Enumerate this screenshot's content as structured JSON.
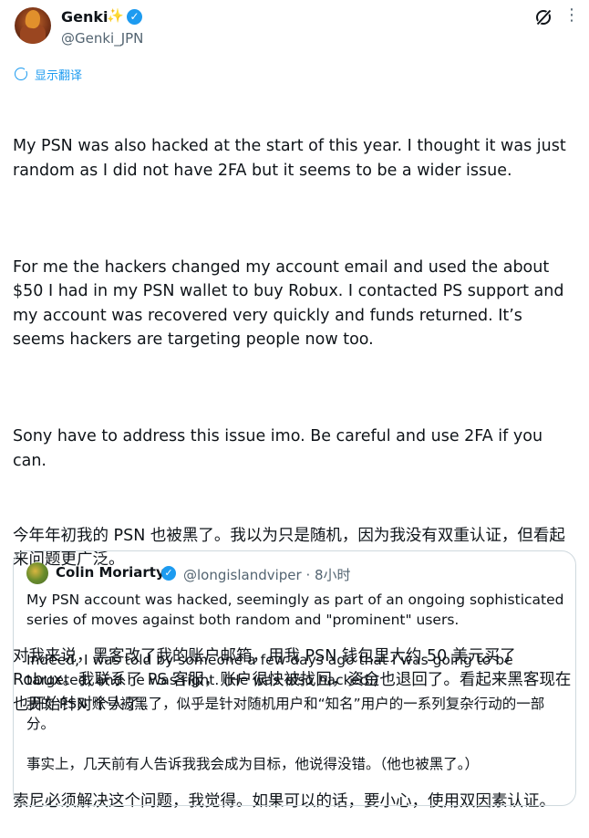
{
  "author": {
    "display_name": "Genki",
    "name_emoji": "✨",
    "handle": "@Genki_JPN"
  },
  "translate_label": "显示翻译",
  "tweet": {
    "en_p1": "My PSN was also hacked at the start of this year. I thought it was just random as I did not have 2FA but it seems to be a wider issue.",
    "en_p2": "For me the hackers changed my account email and used the about $50 I had in my PSN wallet to buy Robux. I contacted PS support and my account was recovered very quickly and funds returned. It’s seems hackers are targeting people now too.",
    "en_p3": "Sony have to address this issue imo. Be careful and use 2FA if you can.",
    "zh_p1": "今年年初我的 PSN 也被黑了。我以为只是随机，因为我没有双重认证，但看起来问题更广泛。",
    "zh_p2": "对我来说，黑客改了我的账户邮箱，用我 PSN 钱包里大约 50 美元买了Robux。我联系了 PS 客服，账户很快被找回，资金也退回了。看起来黑客现在也开始针对个人了。",
    "zh_p3": "索尼必须解决这个问题，我觉得。如果可以的话，要小心，使用双因素认证。"
  },
  "quote": {
    "display_name": "Colin Moriarty",
    "handle_time": "@longislandviper · 8小时",
    "en_p1": "My PSN account was hacked, seemingly as part of an ongoing sophisticated series of moves against both random and \"prominent\" users.",
    "en_p2": "Indeed, I was told by someone a few days ago that I was going to be targeted, and he was right. (He was also hacked.)",
    "zh_p1": "我的 PSN 账号被黑了，似乎是针对随机用户和“知名”用户的一系列复杂行动的一部分。",
    "zh_p2": "事实上，几天前有人告诉我我会成为目标，他说得没错。（他也被黑了。）"
  },
  "colors": {
    "accent": "#1d9bf0",
    "secondary_text": "#536471",
    "border": "#cfd9de"
  }
}
